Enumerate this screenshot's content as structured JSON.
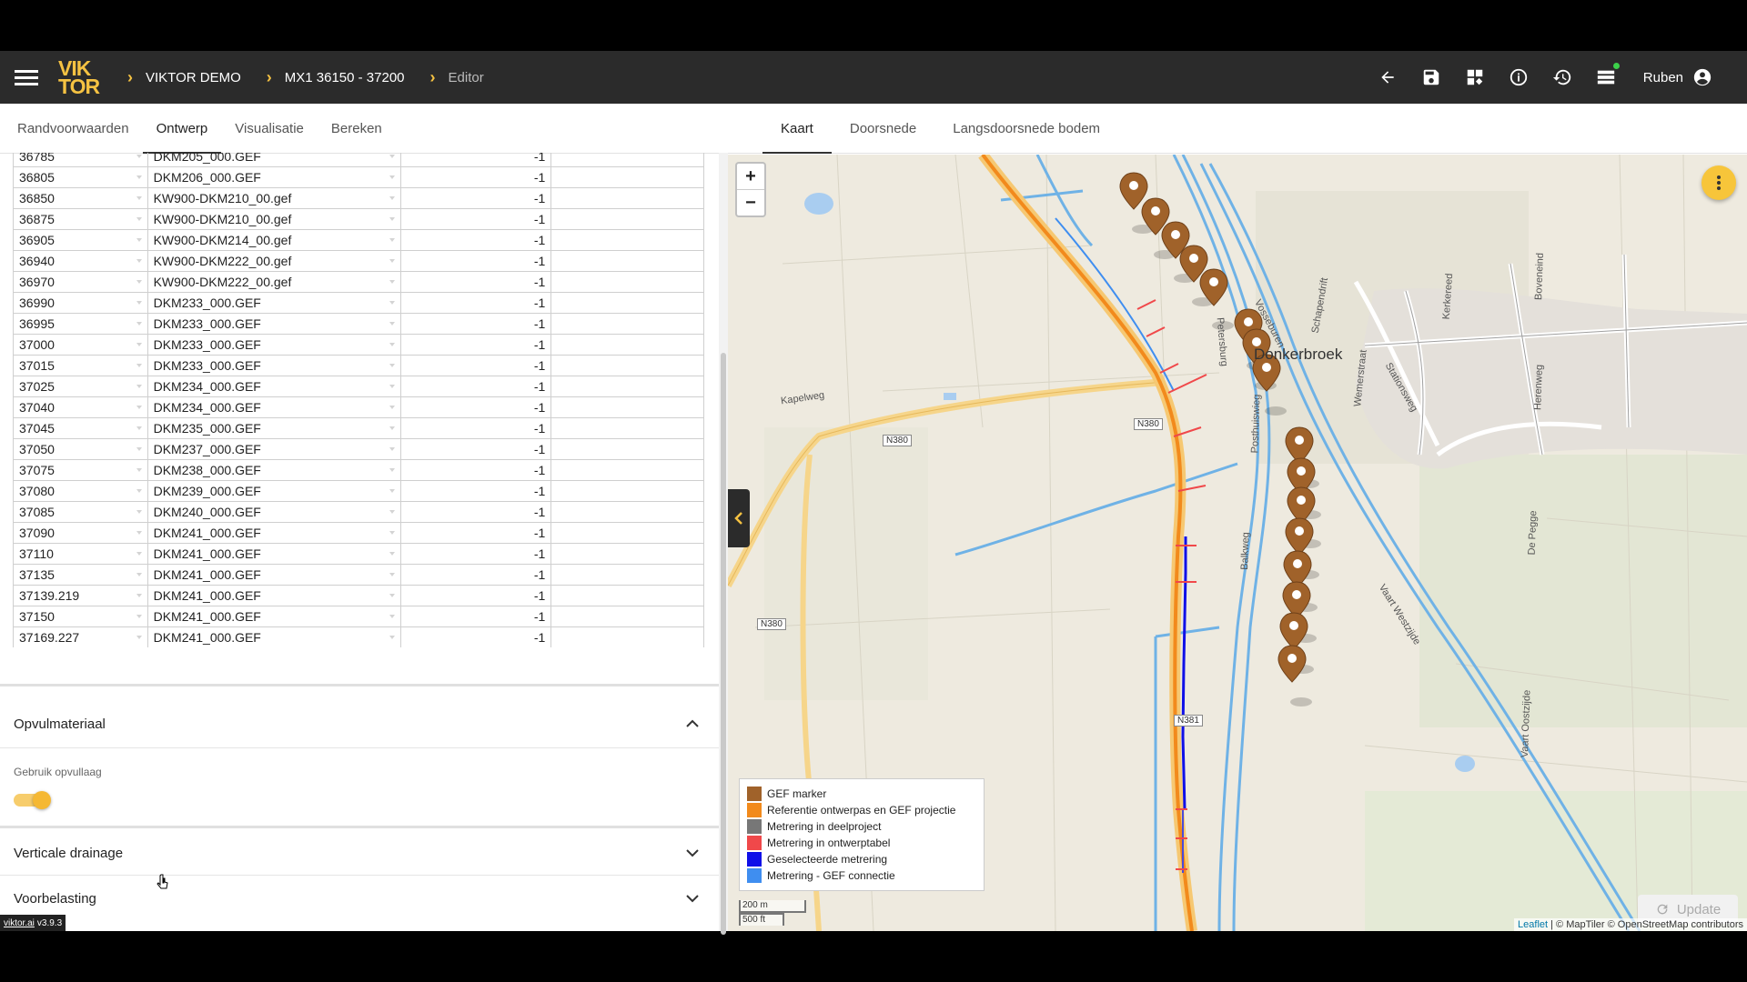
{
  "header": {
    "logo_top": "VIK",
    "logo_bottom": "TOR",
    "breadcrumbs": [
      "VIKTOR DEMO",
      "MX1 36150 - 37200",
      "Editor"
    ],
    "user_name": "Ruben",
    "icons": [
      "arrow-back-icon",
      "save-icon",
      "apps-icon",
      "info-icon",
      "history-icon",
      "queue-icon",
      "account-icon"
    ]
  },
  "left_tabs": [
    "Randvoorwaarden",
    "Ontwerp",
    "Visualisatie",
    "Bereken"
  ],
  "left_active_tab": "Ontwerp",
  "table_rows": [
    [
      "36785",
      "DKM205_000.GEF",
      "-1"
    ],
    [
      "36805",
      "DKM206_000.GEF",
      "-1"
    ],
    [
      "36850",
      "KW900-DKM210_00.gef",
      "-1"
    ],
    [
      "36875",
      "KW900-DKM210_00.gef",
      "-1"
    ],
    [
      "36905",
      "KW900-DKM214_00.gef",
      "-1"
    ],
    [
      "36940",
      "KW900-DKM222_00.gef",
      "-1"
    ],
    [
      "36970",
      "KW900-DKM222_00.gef",
      "-1"
    ],
    [
      "36990",
      "DKM233_000.GEF",
      "-1"
    ],
    [
      "36995",
      "DKM233_000.GEF",
      "-1"
    ],
    [
      "37000",
      "DKM233_000.GEF",
      "-1"
    ],
    [
      "37015",
      "DKM233_000.GEF",
      "-1"
    ],
    [
      "37025",
      "DKM234_000.GEF",
      "-1"
    ],
    [
      "37040",
      "DKM234_000.GEF",
      "-1"
    ],
    [
      "37045",
      "DKM235_000.GEF",
      "-1"
    ],
    [
      "37050",
      "DKM237_000.GEF",
      "-1"
    ],
    [
      "37075",
      "DKM238_000.GEF",
      "-1"
    ],
    [
      "37080",
      "DKM239_000.GEF",
      "-1"
    ],
    [
      "37085",
      "DKM240_000.GEF",
      "-1"
    ],
    [
      "37090",
      "DKM241_000.GEF",
      "-1"
    ],
    [
      "37110",
      "DKM241_000.GEF",
      "-1"
    ],
    [
      "37135",
      "DKM241_000.GEF",
      "-1"
    ],
    [
      "37139.219",
      "DKM241_000.GEF",
      "-1"
    ],
    [
      "37150",
      "DKM241_000.GEF",
      "-1"
    ],
    [
      "37169.227",
      "DKM241_000.GEF",
      "-1"
    ]
  ],
  "sections": {
    "opvul_title": "Opvulmateriaal",
    "opvul_field_label": "Gebruik opvullaag",
    "opvul_toggle_on": true,
    "drainage_title": "Verticale drainage",
    "voorbelasting_title": "Voorbelasting"
  },
  "version": {
    "site": "viktor.ai",
    "number": "v3.9.3"
  },
  "right_tabs": [
    "Kaart",
    "Doorsnede",
    "Langsdoorsnede bodem"
  ],
  "right_active_tab": "Kaart",
  "map": {
    "zoom_in": "+",
    "zoom_out": "−",
    "place_name": "Donkerbroek",
    "streets": [
      "Kapelweg",
      "Petersburg",
      "Vosseburen",
      "Schapendrift",
      "Posthuiswieg",
      "Wemerstraat",
      "Kerkereed",
      "Boveneind",
      "Herenweg",
      "De Pegge",
      "Balkweg",
      "Vaart Westzijde",
      "Vaart Oostzijde",
      "Stationsweg"
    ],
    "road_shields": [
      "N380",
      "N380",
      "N380",
      "N381"
    ],
    "legend": [
      {
        "label": "GEF marker",
        "color": "#a0622a"
      },
      {
        "label": "Referentie ontwerpas en GEF projectie",
        "color": "#f28a1c"
      },
      {
        "label": "Metrering in deelproject",
        "color": "#777777"
      },
      {
        "label": "Metrering in ontwerptabel",
        "color": "#f0484a"
      },
      {
        "label": "Geselecteerde metrering",
        "color": "#1010e8"
      },
      {
        "label": "Metrering - GEF connectie",
        "color": "#3f8ef0"
      }
    ],
    "scale_metric": "200 m",
    "scale_imperial": "500 ft",
    "update_label": "Update",
    "attribution_leaflet": "Leaflet",
    "attribution_rest": " | © MapTiler © OpenStreetMap contributors"
  }
}
